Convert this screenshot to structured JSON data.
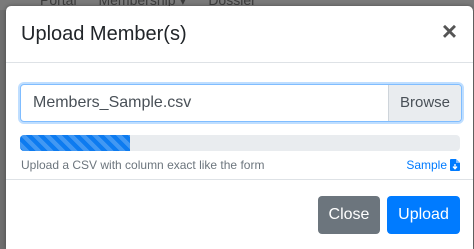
{
  "backdrop": {
    "items": [
      "Portal",
      "Membership ▾",
      "Dossier"
    ]
  },
  "modal": {
    "title": "Upload Member(s)",
    "close_icon": "×",
    "file_input": {
      "value": "Members_Sample.csv",
      "browse_label": "Browse"
    },
    "progress": {
      "percent": 25,
      "color": "#0d7bf0"
    },
    "help_text": "Upload a CSV with column exact like the form",
    "sample_link": {
      "label": "Sample",
      "icon": "file-download-icon"
    },
    "footer": {
      "close_label": "Close",
      "upload_label": "Upload"
    }
  },
  "colors": {
    "primary": "#007bff",
    "secondary": "#6c757d"
  }
}
